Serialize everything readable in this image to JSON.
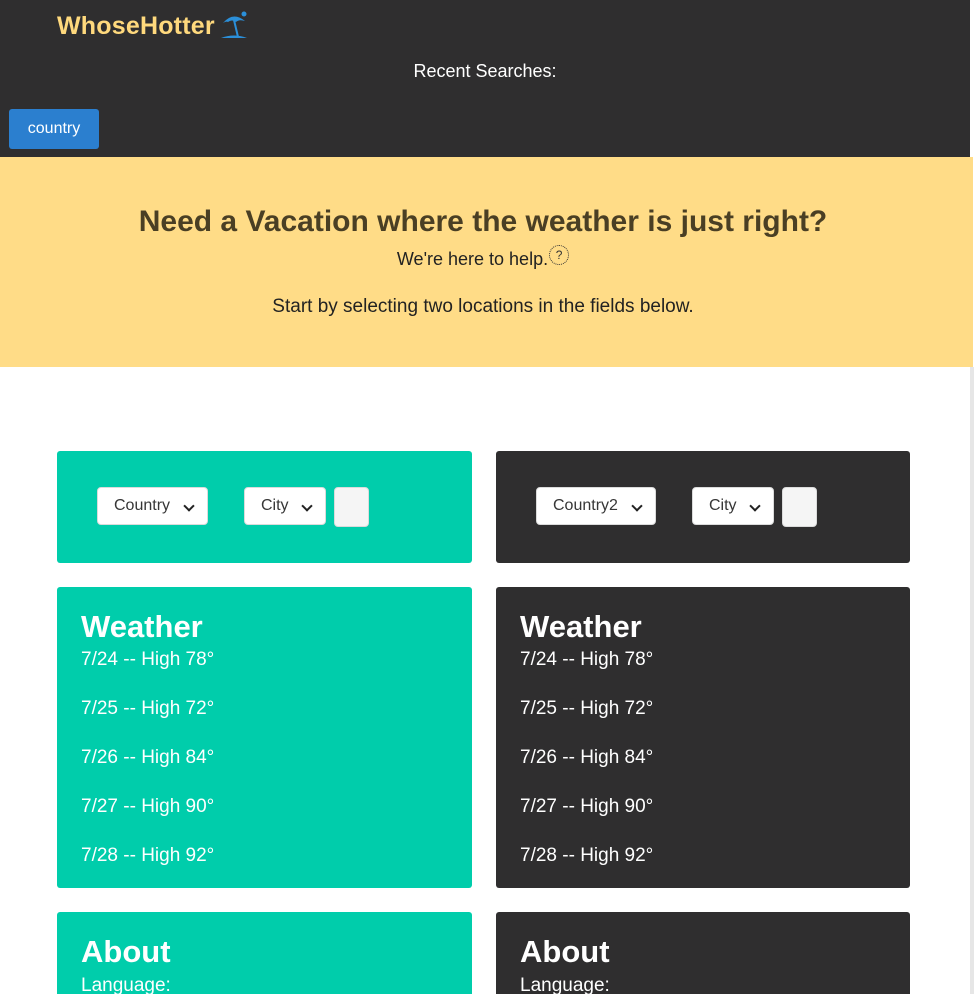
{
  "navbar": {
    "logo_text": "WhoseHotter",
    "logo_icon": "beach-umbrella-icon",
    "recent_title": "Recent Searches:",
    "recent_items": [
      "country"
    ]
  },
  "hero": {
    "title": "Need a Vacation where the weather is just right?",
    "subtitle": "We're here to help.",
    "help_icon_glyph": "?",
    "start_text": "Start by selecting two locations in the fields below."
  },
  "left": {
    "country_select": "Country",
    "city_select": "City",
    "weather_title": "Weather",
    "forecast": [
      "7/24 -- High 78°",
      "7/25 -- High 72°",
      "7/26 -- High 84°",
      "7/27 -- High 90°",
      "7/28 -- High 92°"
    ],
    "about_title": "About",
    "language_label": "Language:"
  },
  "right": {
    "country_select": "Country2",
    "city_select": "City",
    "weather_title": "Weather",
    "forecast": [
      "7/24 -- High 78°",
      "7/25 -- High 72°",
      "7/26 -- High 84°",
      "7/27 -- High 90°",
      "7/28 -- High 92°"
    ],
    "about_title": "About",
    "language_label": "Language:"
  },
  "colors": {
    "navbar_bg": "#2f2e2f",
    "logo": "#ffd97d",
    "hero_bg": "#ffdc87",
    "accent_green": "#00cdab",
    "recent_button": "#2b7fcf"
  }
}
